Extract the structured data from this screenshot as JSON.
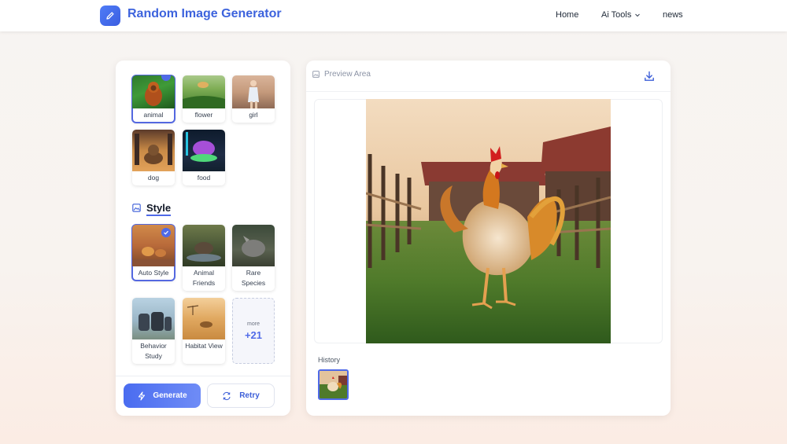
{
  "header": {
    "brand": "Random Image Generator",
    "nav": {
      "home": "Home",
      "ai_tools": "Ai Tools",
      "news": "news"
    }
  },
  "subjects": [
    {
      "label": "animal",
      "selected": true,
      "icon": "orangutan-thumbnail"
    },
    {
      "label": "flower",
      "selected": false,
      "icon": "meadow-thumbnail"
    },
    {
      "label": "girl",
      "selected": false,
      "icon": "girl-thumbnail"
    },
    {
      "label": "dog",
      "selected": false,
      "icon": "dog-thumbnail"
    },
    {
      "label": "food",
      "selected": false,
      "icon": "food-thumbnail"
    }
  ],
  "style": {
    "heading": "Style",
    "options": [
      {
        "label": "Auto Style",
        "selected": true
      },
      {
        "label": "Animal Friends",
        "selected": false
      },
      {
        "label": "Rare Species",
        "selected": false
      },
      {
        "label": "Behavior Study",
        "selected": false
      },
      {
        "label": "Habitat View",
        "selected": false
      }
    ],
    "more_label": "more",
    "more_count": "+21"
  },
  "actions": {
    "generate": "Generate",
    "retry": "Retry"
  },
  "preview": {
    "title": "Preview Area",
    "image": "rooster-on-farm"
  },
  "history": {
    "label": "History"
  },
  "colors": {
    "accent": "#4f6ae8",
    "brand": "#3d63dd"
  }
}
